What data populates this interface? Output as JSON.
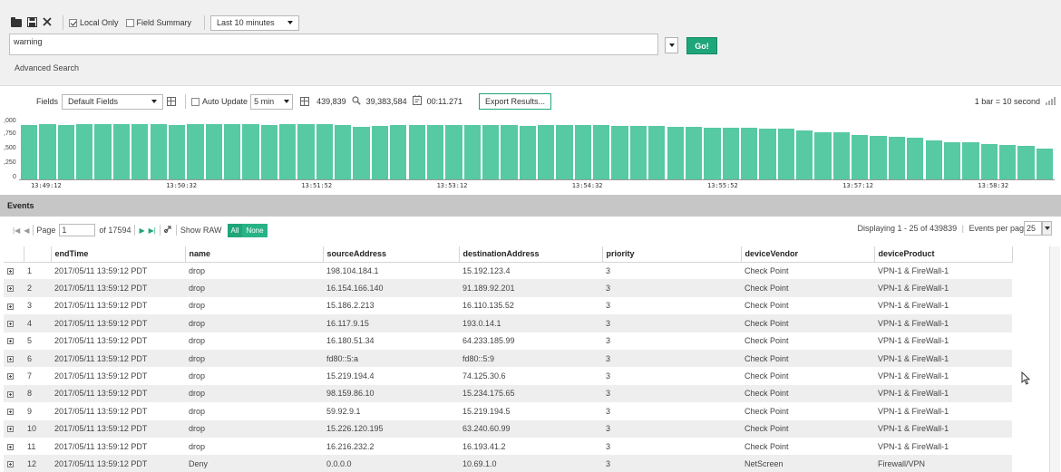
{
  "toolbar": {
    "open_icon": "folder-icon",
    "save_icon": "floppy-disk-icon",
    "clear_icon": "close-icon",
    "local_only_label": "Local Only",
    "local_only_checked": true,
    "field_summary_label": "Field Summary",
    "field_summary_checked": false,
    "time_range": "Last 10 minutes"
  },
  "search": {
    "query": "warning",
    "go_label": "Go!",
    "advanced_label": "Advanced Search"
  },
  "results_bar": {
    "fields_label": "Fields",
    "fields_value": "Default Fields",
    "auto_update_label": "Auto Update",
    "auto_update_interval": "5 min",
    "matched_count": "439,839",
    "scanned_count": "39,383,584",
    "elapsed": "00:11.271",
    "export_label": "Export Results...",
    "bar_scale": "1 bar = 10 second"
  },
  "chart_data": {
    "type": "bar",
    "ytick_labels": [
      ",000",
      ",750",
      ",500",
      ",250",
      "0"
    ],
    "xtick_labels": [
      "13:49:12",
      "13:50:32",
      "13:51:52",
      "13:53:12",
      "13:54:32",
      "13:55:52",
      "13:57:12",
      "13:58:32"
    ],
    "ylim": [
      0,
      1000
    ],
    "values": [
      880,
      905,
      890,
      900,
      900,
      895,
      900,
      905,
      890,
      895,
      900,
      905,
      895,
      890,
      895,
      900,
      895,
      890,
      860,
      870,
      880,
      880,
      885,
      890,
      880,
      885,
      880,
      875,
      880,
      880,
      885,
      880,
      870,
      875,
      870,
      860,
      850,
      845,
      840,
      835,
      820,
      820,
      800,
      760,
      760,
      720,
      700,
      690,
      680,
      640,
      610,
      600,
      580,
      560,
      540,
      500
    ]
  },
  "events": {
    "title": "Events",
    "page_label": "Page",
    "page_value": "1",
    "page_total": "of 17594",
    "show_raw_label": "Show RAW",
    "all_label": "All",
    "none_label": "None",
    "display_info": "Displaying 1 - 25 of 439839",
    "per_page_label": "Events per page",
    "per_page_value": "25",
    "columns": [
      "endTime",
      "name",
      "sourceAddress",
      "destinationAddress",
      "priority",
      "deviceVendor",
      "deviceProduct"
    ],
    "rows": [
      {
        "n": "1",
        "cells": [
          "2017/05/11 13:59:12 PDT",
          "drop",
          "198.104.184.1",
          "15.192.123.4",
          "3",
          "Check Point",
          "VPN-1 & FireWall-1"
        ]
      },
      {
        "n": "2",
        "cells": [
          "2017/05/11 13:59:12 PDT",
          "drop",
          "16.154.166.140",
          "91.189.92.201",
          "3",
          "Check Point",
          "VPN-1 & FireWall-1"
        ]
      },
      {
        "n": "3",
        "cells": [
          "2017/05/11 13:59:12 PDT",
          "drop",
          "15.186.2.213",
          "16.110.135.52",
          "3",
          "Check Point",
          "VPN-1 & FireWall-1"
        ]
      },
      {
        "n": "4",
        "cells": [
          "2017/05/11 13:59:12 PDT",
          "drop",
          "16.117.9.15",
          "193.0.14.1",
          "3",
          "Check Point",
          "VPN-1 & FireWall-1"
        ]
      },
      {
        "n": "5",
        "cells": [
          "2017/05/11 13:59:12 PDT",
          "drop",
          "16.180.51.34",
          "64.233.185.99",
          "3",
          "Check Point",
          "VPN-1 & FireWall-1"
        ]
      },
      {
        "n": "6",
        "cells": [
          "2017/05/11 13:59:12 PDT",
          "drop",
          "fd80::5:a",
          "fd80::5:9",
          "3",
          "Check Point",
          "VPN-1 & FireWall-1"
        ]
      },
      {
        "n": "7",
        "cells": [
          "2017/05/11 13:59:12 PDT",
          "drop",
          "15.219.194.4",
          "74.125.30.6",
          "3",
          "Check Point",
          "VPN-1 & FireWall-1"
        ]
      },
      {
        "n": "8",
        "cells": [
          "2017/05/11 13:59:12 PDT",
          "drop",
          "98.159.86.10",
          "15.234.175.65",
          "3",
          "Check Point",
          "VPN-1 & FireWall-1"
        ]
      },
      {
        "n": "9",
        "cells": [
          "2017/05/11 13:59:12 PDT",
          "drop",
          "59.92.9.1",
          "15.219.194.5",
          "3",
          "Check Point",
          "VPN-1 & FireWall-1"
        ]
      },
      {
        "n": "10",
        "cells": [
          "2017/05/11 13:59:12 PDT",
          "drop",
          "15.226.120.195",
          "63.240.60.99",
          "3",
          "Check Point",
          "VPN-1 & FireWall-1"
        ]
      },
      {
        "n": "11",
        "cells": [
          "2017/05/11 13:59:12 PDT",
          "drop",
          "16.216.232.2",
          "16.193.41.2",
          "3",
          "Check Point",
          "VPN-1 & FireWall-1"
        ]
      },
      {
        "n": "12",
        "cells": [
          "2017/05/11 13:59:12 PDT",
          "Deny",
          "0.0.0.0",
          "10.69.1.0",
          "3",
          "NetScreen",
          "Firewall/VPN"
        ]
      }
    ]
  },
  "colors": {
    "accent": "#1fa57a",
    "bar": "#57c9a3",
    "events_header_bg": "#c6c6c6",
    "row_alt": "#eeeeee"
  }
}
